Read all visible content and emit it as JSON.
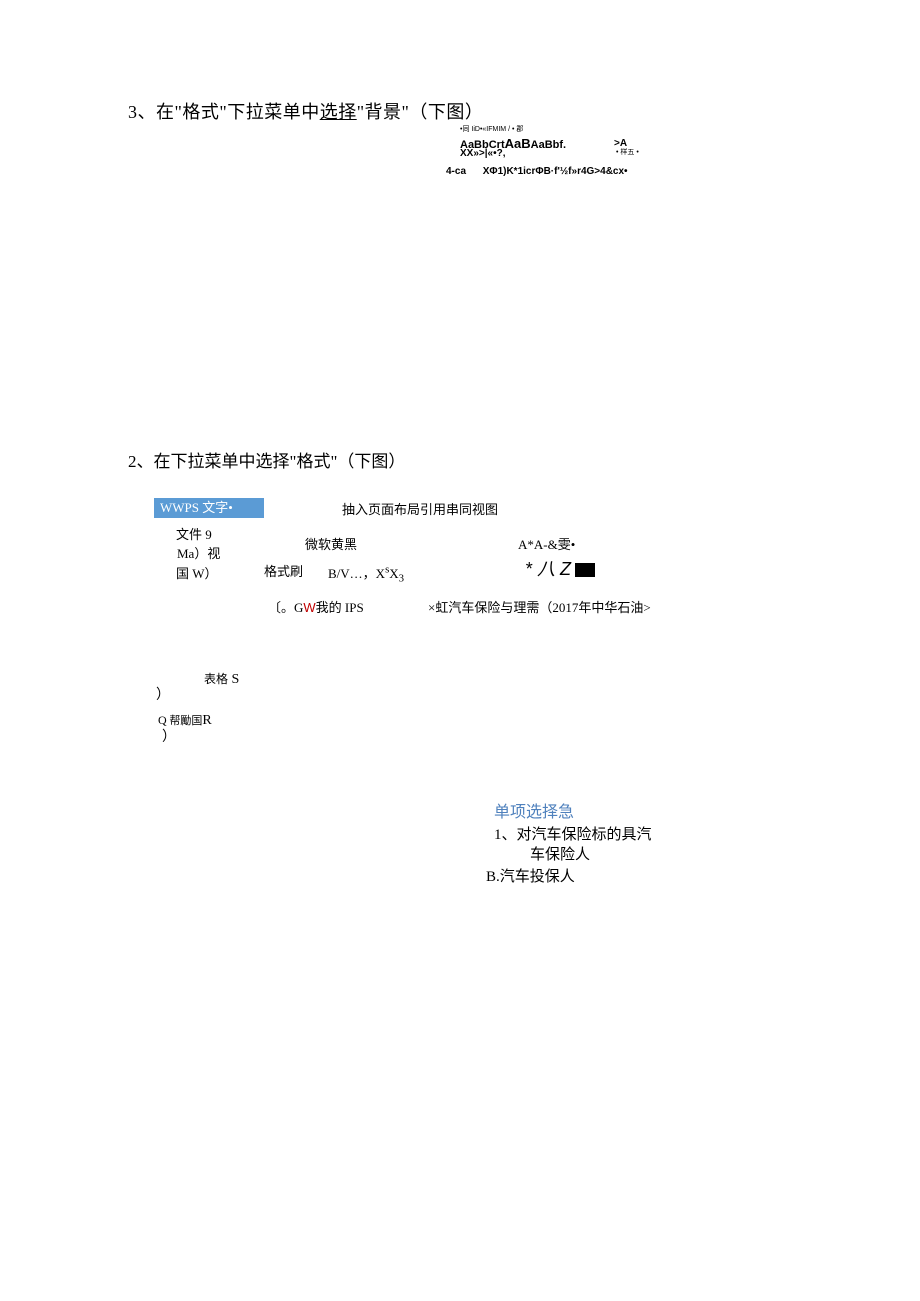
{
  "section3": {
    "prefix": "3",
    "title_part1": "、在\"格式\"下拉菜单中",
    "title_underline": "选择",
    "title_part2": "\"背景\"（下图）",
    "tiny_caption": "•同 IiD•«IFMIM / • 郡",
    "styles": "AaBbCrt",
    "styles_big": "AaB",
    "styles2": "AaBbf.",
    "styles_sub": "XX»>|«•?,",
    "ext": ">A",
    "ext_sub": "• 样五 •",
    "garbled_a": "4-ca",
    "garbled_b": "XΦ1)K*1icrΦB·f'½f»r4G>4&cx•"
  },
  "section2": {
    "prefix": "2",
    "title": "、在下拉菜单中选择\"格式\"（下图）",
    "wps_bar": "WWPS 文字•",
    "tabs": "抽入页面布局引用串同视图",
    "file": "文件 9",
    "ma": "Ma）视",
    "country": "国 W）",
    "font": "微软黄黑",
    "brush": "格式刷",
    "bv": "B/V…，X",
    "bv_sup": "s",
    "bv2": "X",
    "bv2_sub": "3",
    "aa": "A*A-&雯•",
    "star": "* 八 Z",
    "ips_pre": "〔。G",
    "ips_red": "W",
    "ips_post": "我的 IPS",
    "car_pre": "×虹汽车保险与理需（",
    "car_year": "2017",
    "car_post": "年中华石油>",
    "table": "表格",
    "table_s": " S",
    "paren1": "）",
    "help_q": "Q",
    "help_ch": " 帮勵国",
    "help_r": "R",
    "paren2": "）"
  },
  "content": {
    "choice_title": "单项选择急",
    "c1_a": "1、对汽车保险标的具汽",
    "c1_b": "车保险人",
    "cb_latin": "B.",
    "cb": "汽车投保人"
  }
}
